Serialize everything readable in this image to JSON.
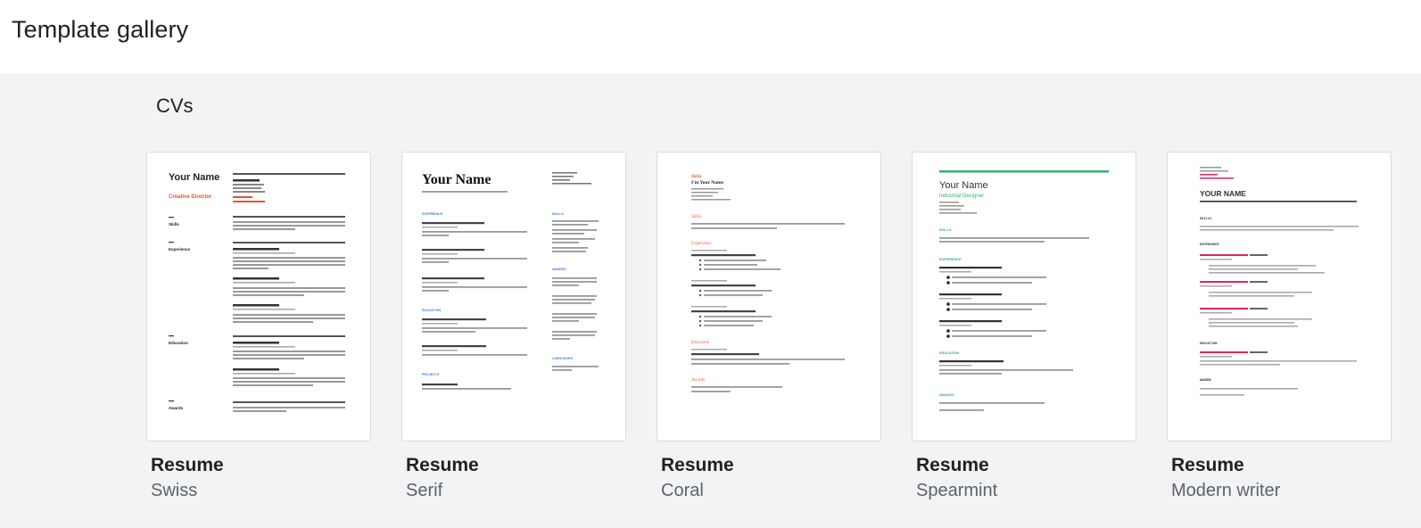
{
  "header": {
    "title": "Template gallery"
  },
  "section": {
    "title": "CVs"
  },
  "templates": [
    {
      "category": "Resume",
      "name": "Swiss",
      "preview": {
        "name": "Your Name",
        "subtitle": "Creative Director",
        "sections": [
          "Skills",
          "Experience",
          "Education",
          "Awards"
        ]
      }
    },
    {
      "category": "Resume",
      "name": "Serif",
      "preview": {
        "name": "Your Name",
        "sections": [
          "EXPERIENCE",
          "EDUCATION",
          "PROJECTS",
          "SKILLS",
          "AWARDS",
          "LANGUAGES"
        ]
      }
    },
    {
      "category": "Resume",
      "name": "Coral",
      "preview": {
        "greeting": "Hello",
        "name": "I'm Your Name",
        "sections": [
          "Skills",
          "Experience",
          "Education",
          "Awards"
        ]
      }
    },
    {
      "category": "Resume",
      "name": "Spearmint",
      "preview": {
        "name": "Your Name",
        "subtitle": "Industrial Designer",
        "sections": [
          "SKILLS",
          "EXPERIENCE",
          "EDUCATION",
          "AWARDS"
        ]
      }
    },
    {
      "category": "Resume",
      "name": "Modern writer",
      "preview": {
        "name": "YOUR NAME",
        "sections": [
          "SKILLS",
          "EXPERIENCE",
          "EDUCATION",
          "AWARDS"
        ]
      }
    }
  ],
  "colors": {
    "swiss_accent": "#e8542e",
    "serif_accent": "#3b82d6",
    "coral_accent": "#f0614b",
    "spearmint_accent": "#34b36a",
    "modern_accent": "#e4245d"
  }
}
